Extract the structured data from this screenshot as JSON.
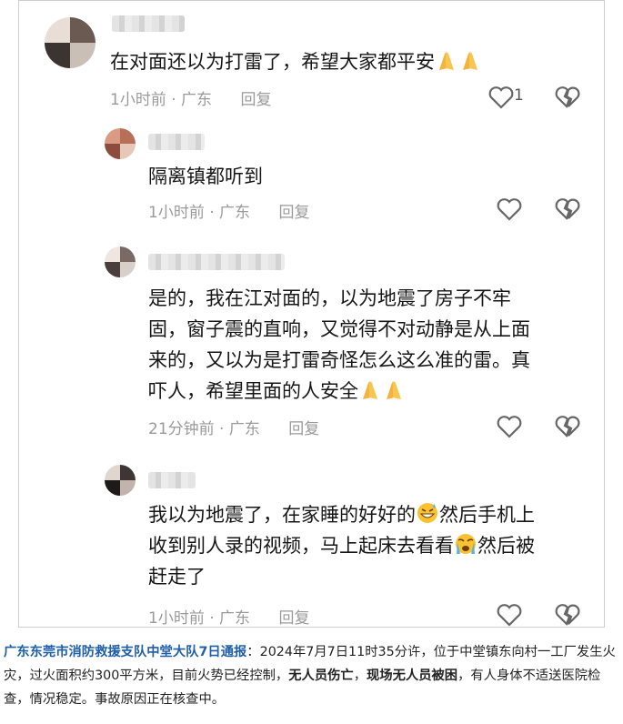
{
  "comments": [
    {
      "text": "在对面还以为打雷了，希望大家都平安",
      "emojis": [
        "folded-hands",
        "folded-hands"
      ],
      "time": "1小时前",
      "location": "广东",
      "reply_label": "回复",
      "likes": "1"
    },
    {
      "text": "隔离镇都听到",
      "time": "1小时前",
      "location": "广东",
      "reply_label": "回复",
      "likes": ""
    },
    {
      "text_lines": [
        "是的，我在江对面的，以为地震了房子不牢",
        "固，窗子震的直响，又觉得不对动静是从上面",
        "来的，又以为是打雷奇怪怎么这么准的雷。真",
        "吓人，希望里面的人安全"
      ],
      "emojis": [
        "folded-hands",
        "folded-hands"
      ],
      "time": "21分钟前",
      "location": "广东",
      "reply_label": "回复",
      "likes": ""
    },
    {
      "text_line1a": "我以为地震了，在家睡的好好的",
      "text_line1b": "然后手机上",
      "text_line2a": "收到别人录的视频，马上起床去看看",
      "text_line2b": "然后被",
      "text_line3": "赶走了",
      "emojis": [
        "grinning-sweat-face",
        "crying-face"
      ],
      "time": "1小时前",
      "location": "广东",
      "reply_label": "回复",
      "likes": ""
    }
  ],
  "separator": "·",
  "caption": {
    "lead": "广东东莞市消防救援支队中堂大队7日通报",
    "part1": "：2024年7月7日11时35分许，位于中堂镇东向村一工厂发生火灾，过火面积约300平方米，目前火势已经控制，",
    "bold1": "无人员伤亡",
    "part2": "，",
    "bold2": "现场无人员被困",
    "part3": "，有人身体不适送医院检查，情况稳定。事故原因正在核查中。"
  },
  "colors": {
    "lead": "#1f5fa8",
    "meta": "#9a9a9a",
    "icon": "#666666"
  }
}
